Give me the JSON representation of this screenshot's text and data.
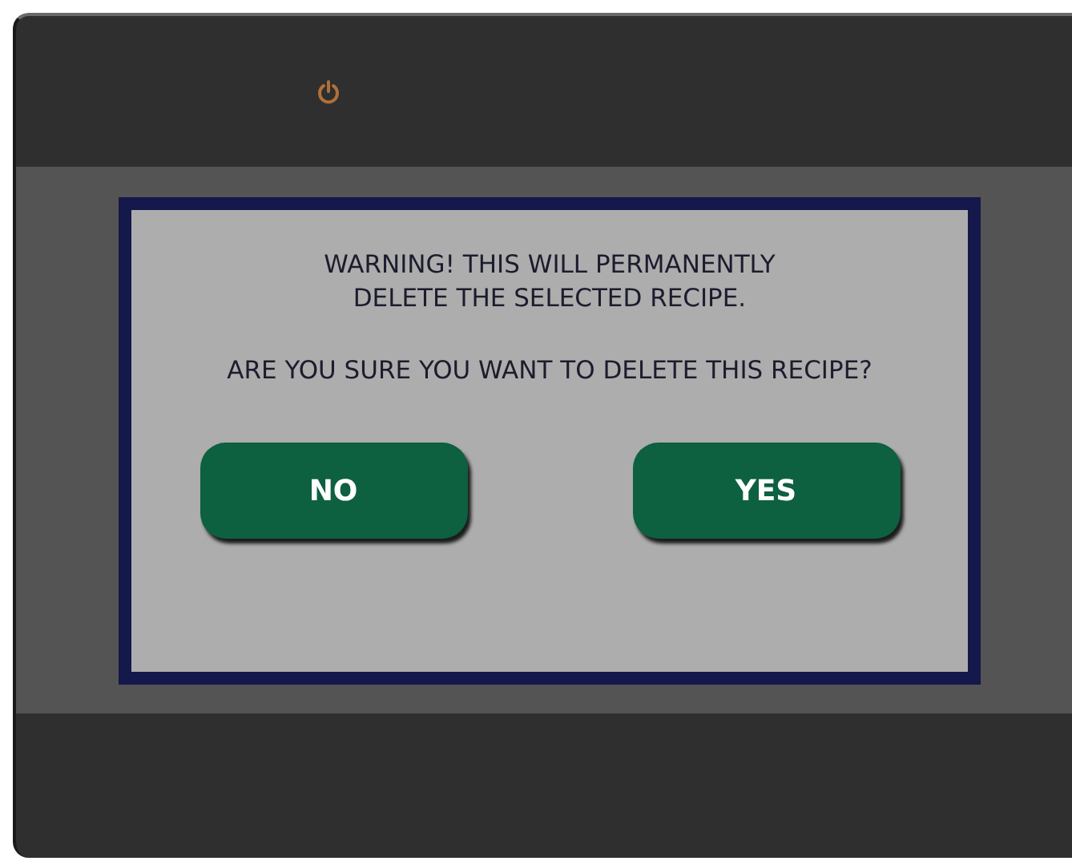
{
  "dialog": {
    "warning_lines": [
      "WARNING! THIS WILL PERMANENTLY",
      "DELETE THE SELECTED RECIPE."
    ],
    "question": "ARE YOU SURE YOU WANT TO DELETE THIS RECIPE?",
    "buttons": [
      {
        "label": "NO"
      },
      {
        "label": "YES"
      }
    ]
  }
}
